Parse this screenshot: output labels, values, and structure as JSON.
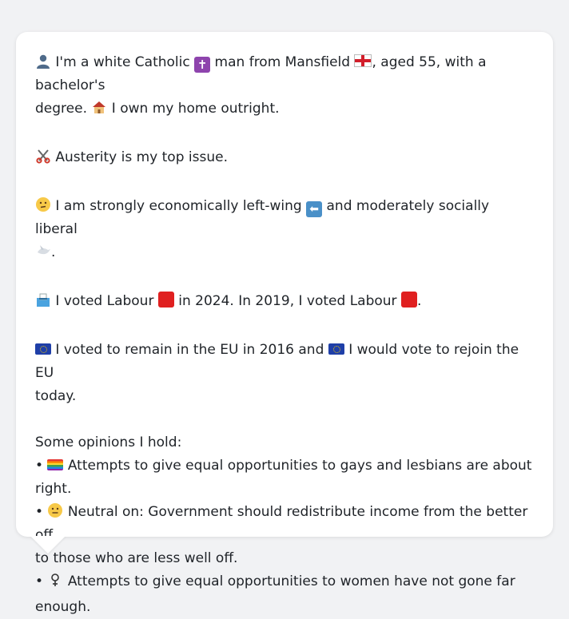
{
  "paragraphs": {
    "p1": {
      "a1": "I'm a white Catholic",
      "a2": "man from Mansfield",
      "a3": ", aged 55, with a bachelor's",
      "b1": "degree.",
      "b2": "I own my home outright."
    },
    "p2": {
      "text": "Austerity is my top issue."
    },
    "p3": {
      "a1": "I am strongly economically left-wing",
      "a2": "and moderately socially liberal",
      "b1": "."
    },
    "p4": {
      "a1": "I voted Labour",
      "a2": "in 2024. In 2019, I voted Labour",
      "a3": "."
    },
    "p5": {
      "a1": "I voted to remain in the EU in 2016 and",
      "a2": "I would vote to rejoin the EU",
      "b1": "today."
    },
    "opinions": {
      "heading": "Some opinions I hold:",
      "bullet": "•",
      "o1a": "Attempts to give equal opportunities to gays and lesbians are about",
      "o1b": "right.",
      "o2a": "Neutral on: Government should redistribute income from the better off",
      "o2b": "to those who are less well off.",
      "o3a": "Attempts to give equal opportunities to women have not gone far",
      "o3b": "enough."
    }
  },
  "icons": {
    "person": "bust-in-silhouette-icon",
    "cross": "latin-cross-icon",
    "england": "england-flag-icon",
    "house": "house-icon",
    "scissors": "scissors-icon",
    "thinking": "thinking-face-icon",
    "left_arrow": "left-arrow-icon",
    "dove": "dove-icon",
    "ballot": "ballot-box-icon",
    "labour": "red-square-icon",
    "eu": "eu-flag-icon",
    "rainbow": "rainbow-flag-icon",
    "neutral": "neutral-face-icon",
    "female": "female-sign-icon"
  },
  "colors": {
    "labour_red": "#e02020",
    "bubble_bg": "#ffffff",
    "page_bg": "#f1f2f4"
  }
}
